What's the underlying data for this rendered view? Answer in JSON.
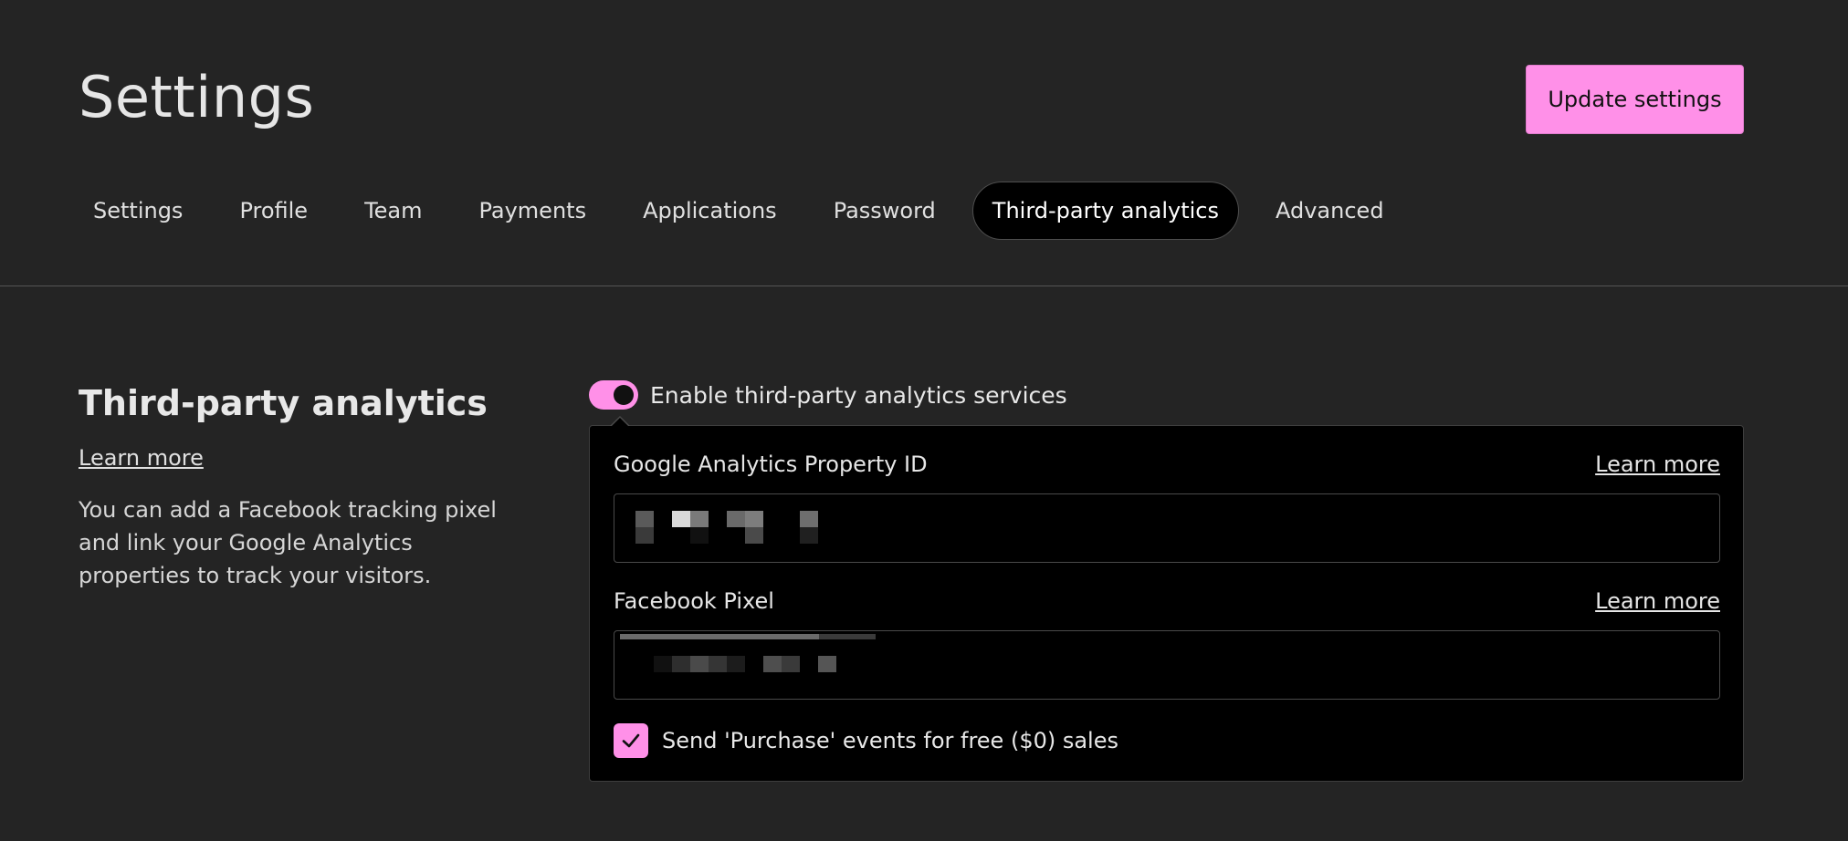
{
  "header": {
    "title": "Settings",
    "update_button": "Update settings"
  },
  "tabs": [
    {
      "label": "Settings",
      "active": false
    },
    {
      "label": "Profile",
      "active": false
    },
    {
      "label": "Team",
      "active": false
    },
    {
      "label": "Payments",
      "active": false
    },
    {
      "label": "Applications",
      "active": false
    },
    {
      "label": "Password",
      "active": false
    },
    {
      "label": "Third-party analytics",
      "active": true
    },
    {
      "label": "Advanced",
      "active": false
    }
  ],
  "section": {
    "title": "Third-party analytics",
    "learn_more": "Learn more",
    "description": "You can add a Facebook tracking pixel and link your Google Analytics properties to track your visitors."
  },
  "toggle": {
    "label": "Enable third-party analytics services",
    "on": true
  },
  "fields": {
    "google": {
      "label": "Google Analytics Property ID",
      "learn_more": "Learn more",
      "value_redacted": true
    },
    "facebook": {
      "label": "Facebook Pixel",
      "learn_more": "Learn more",
      "value_redacted": true,
      "loading_progress": 0.78
    }
  },
  "checkbox": {
    "label": "Send 'Purchase' events for free ($0) sales",
    "checked": true
  },
  "colors": {
    "accent": "#ff90e8",
    "background": "#242424",
    "panel": "#000000"
  }
}
